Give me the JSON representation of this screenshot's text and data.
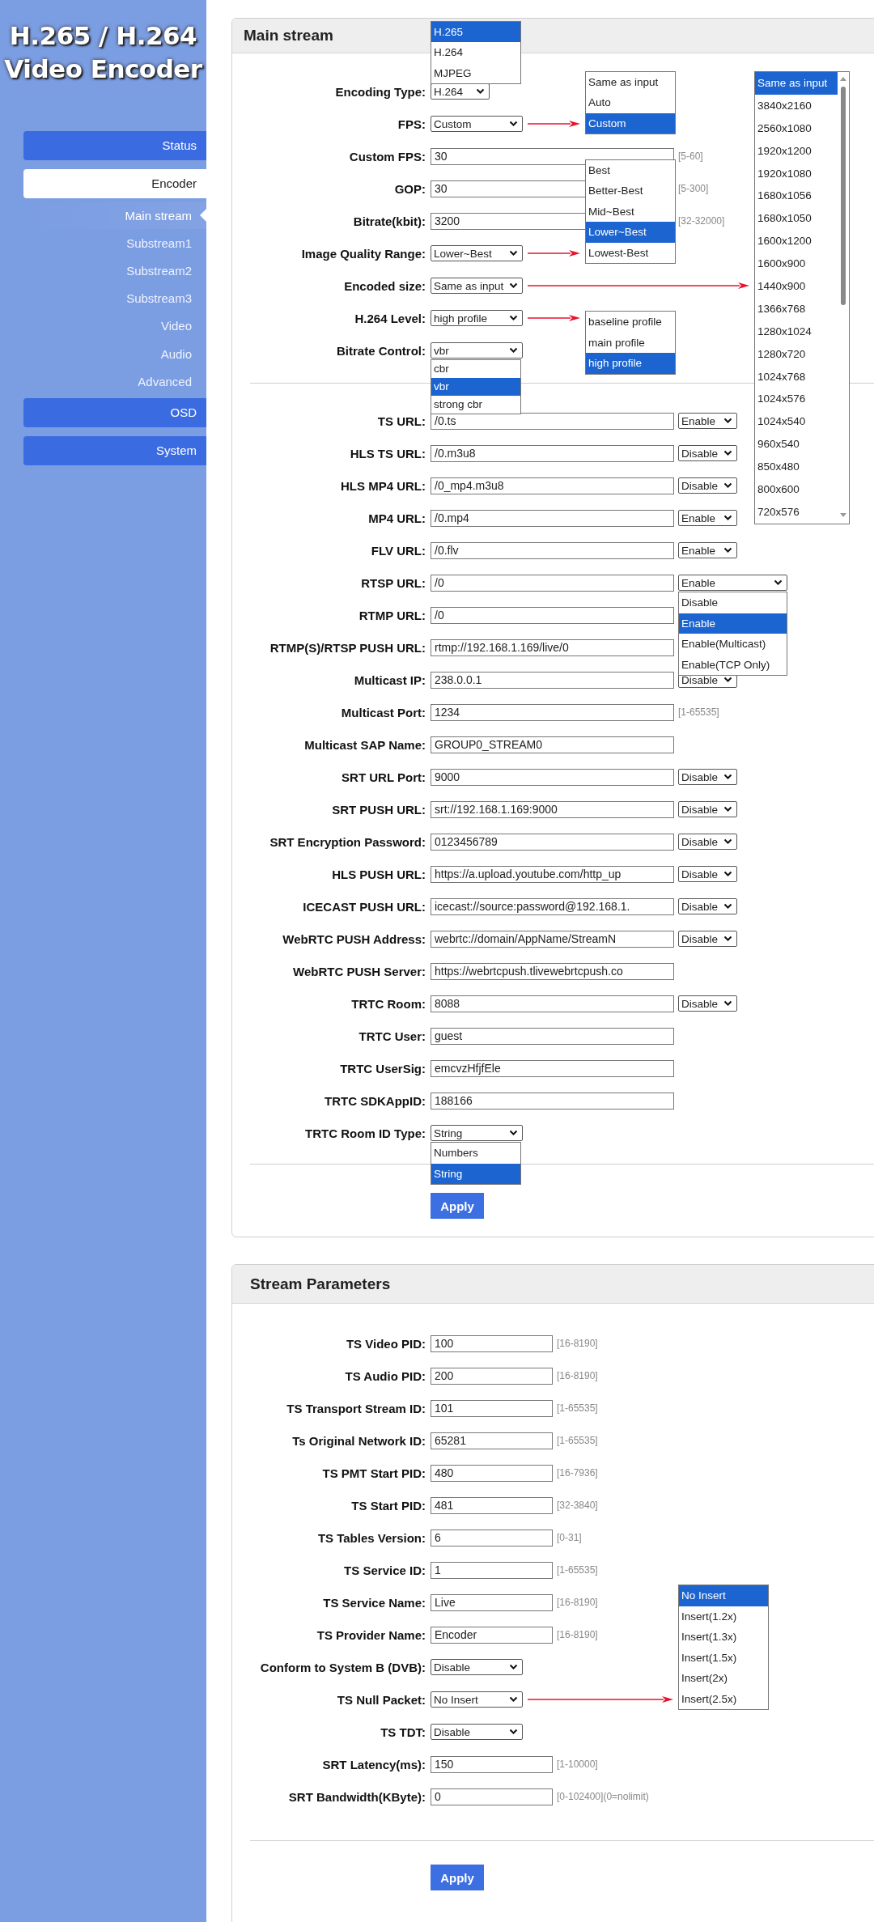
{
  "brand": {
    "title_lines": [
      "H.265 / H.264",
      "Video Encoder"
    ]
  },
  "sidebar": {
    "items": [
      {
        "label": "Status",
        "kind": "button",
        "selected": false
      },
      {
        "label": "Encoder",
        "kind": "button",
        "selected": true
      },
      {
        "label": "Main stream",
        "kind": "subitem",
        "selected": true
      },
      {
        "label": "Substream1",
        "kind": "subitem",
        "selected": false
      },
      {
        "label": "Substream2",
        "kind": "subitem",
        "selected": false
      },
      {
        "label": "Substream3",
        "kind": "subitem",
        "selected": false
      },
      {
        "label": "Video",
        "kind": "subitem",
        "selected": false
      },
      {
        "label": "Audio",
        "kind": "subitem",
        "selected": false
      },
      {
        "label": "Advanced",
        "kind": "subitem",
        "selected": false
      },
      {
        "label": "OSD",
        "kind": "button",
        "selected": false
      },
      {
        "label": "System",
        "kind": "button",
        "selected": false
      }
    ]
  },
  "panels": [
    {
      "title": "Main stream",
      "kind": "wide",
      "apply": "Apply",
      "sections": [
        [
          {
            "label": "Encoding Type:",
            "kind": "compact-select",
            "value": "H.264",
            "dropdown": {
              "options": [
                {
                  "label": "H.265",
                  "selected": true
                },
                {
                  "label": "H.264",
                  "selected": false
                },
                {
                  "label": "MJPEG",
                  "selected": false
                }
              ]
            }
          },
          {
            "label": "FPS:",
            "kind": "select",
            "value": "Custom",
            "dropdown": {
              "options": [
                {
                  "label": "Same as input",
                  "selected": false
                },
                {
                  "label": "Auto",
                  "selected": false
                },
                {
                  "label": "Custom",
                  "selected": true
                }
              ]
            }
          },
          {
            "label": "Custom FPS:",
            "kind": "text",
            "value": "30",
            "side": {
              "kind": "hint",
              "text": "[5-60]"
            }
          },
          {
            "label": "GOP:",
            "kind": "text",
            "value": "30",
            "side": {
              "kind": "hint",
              "text": "[5-300]"
            }
          },
          {
            "label": "Bitrate(kbit):",
            "kind": "text",
            "value": "3200",
            "side": {
              "kind": "hint",
              "text": "[32-32000]"
            }
          },
          {
            "label": "Image Quality Range:",
            "kind": "select",
            "value": "Lower~Best",
            "dropdown": {
              "options": [
                {
                  "label": "Best",
                  "selected": false
                },
                {
                  "label": "Better-Best",
                  "selected": false
                },
                {
                  "label": "Mid~Best",
                  "selected": false
                },
                {
                  "label": "Lower~Best",
                  "selected": true
                },
                {
                  "label": "Lowest-Best",
                  "selected": false
                }
              ]
            }
          },
          {
            "label": "Encoded size:",
            "kind": "select",
            "value": "Same as input",
            "dropdown": {
              "options": [
                {
                  "label": "Same as input",
                  "selected": true
                },
                {
                  "label": "3840x2160",
                  "selected": false
                },
                {
                  "label": "2560x1080",
                  "selected": false
                },
                {
                  "label": "1920x1200",
                  "selected": false
                },
                {
                  "label": "1920x1080",
                  "selected": false
                },
                {
                  "label": "1680x1056",
                  "selected": false
                },
                {
                  "label": "1680x1050",
                  "selected": false
                },
                {
                  "label": "1600x1200",
                  "selected": false
                },
                {
                  "label": "1600x900",
                  "selected": false
                },
                {
                  "label": "1440x900",
                  "selected": false
                },
                {
                  "label": "1366x768",
                  "selected": false
                },
                {
                  "label": "1280x1024",
                  "selected": false
                },
                {
                  "label": "1280x720",
                  "selected": false
                },
                {
                  "label": "1024x768",
                  "selected": false
                },
                {
                  "label": "1024x576",
                  "selected": false
                },
                {
                  "label": "1024x540",
                  "selected": false
                },
                {
                  "label": "960x540",
                  "selected": false
                },
                {
                  "label": "850x480",
                  "selected": false
                },
                {
                  "label": "800x600",
                  "selected": false
                },
                {
                  "label": "720x576",
                  "selected": false
                }
              ]
            }
          },
          {
            "label": "H.264 Level:",
            "kind": "select",
            "value": "high profile",
            "dropdown": {
              "options": [
                {
                  "label": "baseline profile",
                  "selected": false
                },
                {
                  "label": "main profile",
                  "selected": false
                },
                {
                  "label": "high profile",
                  "selected": true
                }
              ]
            }
          },
          {
            "label": "Bitrate Control:",
            "kind": "select",
            "value": "vbr",
            "dropdown": {
              "options": [
                {
                  "label": "cbr",
                  "selected": false
                },
                {
                  "label": "vbr",
                  "selected": true
                },
                {
                  "label": "strong cbr",
                  "selected": false
                }
              ]
            }
          }
        ],
        [
          {
            "label": "TS URL:",
            "kind": "text",
            "value": "/0.ts",
            "side": {
              "kind": "select",
              "value": "Enable"
            }
          },
          {
            "label": "HLS TS URL:",
            "kind": "text",
            "value": "/0.m3u8",
            "side": {
              "kind": "select",
              "value": "Disable"
            }
          },
          {
            "label": "HLS MP4 URL:",
            "kind": "text",
            "value": "/0_mp4.m3u8",
            "side": {
              "kind": "select",
              "value": "Disable"
            }
          },
          {
            "label": "MP4 URL:",
            "kind": "text",
            "value": "/0.mp4",
            "side": {
              "kind": "select",
              "value": "Enable"
            }
          },
          {
            "label": "FLV URL:",
            "kind": "text",
            "value": "/0.flv",
            "side": {
              "kind": "select",
              "value": "Enable"
            }
          },
          {
            "label": "RTSP URL:",
            "kind": "text",
            "value": "/0",
            "side": {
              "kind": "select",
              "value": "Enable",
              "dropdown": {
                "options": [
                  {
                    "label": "Disable",
                    "selected": false
                  },
                  {
                    "label": "Enable",
                    "selected": true
                  },
                  {
                    "label": "Enable(Multicast)",
                    "selected": false
                  },
                  {
                    "label": "Enable(TCP Only)",
                    "selected": false
                  }
                ]
              }
            }
          },
          {
            "label": "RTMP URL:",
            "kind": "text",
            "value": "/0"
          },
          {
            "label": "RTMP(S)/RTSP PUSH URL:",
            "kind": "text",
            "value": "rtmp://192.168.1.169/live/0"
          },
          {
            "label": "Multicast IP:",
            "kind": "text",
            "value": "238.0.0.1",
            "side": {
              "kind": "select",
              "value": "Disable"
            }
          },
          {
            "label": "Multicast Port:",
            "kind": "text",
            "value": "1234",
            "side": {
              "kind": "hint",
              "text": "[1-65535]"
            }
          },
          {
            "label": "Multicast SAP Name:",
            "kind": "text",
            "value": "GROUP0_STREAM0"
          },
          {
            "label": "SRT URL Port:",
            "kind": "text",
            "value": "9000",
            "side": {
              "kind": "select",
              "value": "Disable"
            }
          },
          {
            "label": "SRT PUSH URL:",
            "kind": "text",
            "value": "srt://192.168.1.169:9000",
            "side": {
              "kind": "select",
              "value": "Disable"
            }
          },
          {
            "label": "SRT Encryption Password:",
            "kind": "text",
            "value": "0123456789",
            "side": {
              "kind": "select",
              "value": "Disable"
            }
          },
          {
            "label": "HLS PUSH URL:",
            "kind": "text",
            "value": "https://a.upload.youtube.com/http_up",
            "side": {
              "kind": "select",
              "value": "Disable"
            }
          },
          {
            "label": "ICECAST PUSH URL:",
            "kind": "text",
            "value": "icecast://source:password@192.168.1.",
            "side": {
              "kind": "select",
              "value": "Disable"
            }
          },
          {
            "label": "WebRTC PUSH Address:",
            "kind": "text",
            "value": "webrtc://domain/AppName/StreamN",
            "side": {
              "kind": "select",
              "value": "Disable"
            }
          },
          {
            "label": "WebRTC PUSH Server:",
            "kind": "text",
            "value": "https://webrtcpush.tlivewebrtcpush.co"
          },
          {
            "label": "TRTC Room:",
            "kind": "text",
            "value": "8088",
            "side": {
              "kind": "select",
              "value": "Disable"
            }
          },
          {
            "label": "TRTC User:",
            "kind": "text",
            "value": "guest"
          },
          {
            "label": "TRTC UserSig:",
            "kind": "text",
            "value": "emcvzHfjfEle"
          },
          {
            "label": "TRTC SDKAppID:",
            "kind": "text",
            "value": "188166"
          },
          {
            "label": "TRTC Room ID Type:",
            "kind": "select",
            "value": "String",
            "dropdown": {
              "options": [
                {
                  "label": "Numbers",
                  "selected": false
                },
                {
                  "label": "String",
                  "selected": true
                }
              ]
            }
          }
        ]
      ]
    },
    {
      "title": "Stream Parameters",
      "kind": "narrow",
      "apply": "Apply",
      "sections": [
        [
          {
            "label": "TS Video PID:",
            "kind": "text",
            "value": "100",
            "side": {
              "kind": "hint",
              "text": "[16-8190]"
            }
          },
          {
            "label": "TS Audio PID:",
            "kind": "text",
            "value": "200",
            "side": {
              "kind": "hint",
              "text": "[16-8190]"
            }
          },
          {
            "label": "TS Transport Stream ID:",
            "kind": "text",
            "value": "101",
            "side": {
              "kind": "hint",
              "text": "[1-65535]"
            }
          },
          {
            "label": "Ts Original Network ID:",
            "kind": "text",
            "value": "65281",
            "side": {
              "kind": "hint",
              "text": "[1-65535]"
            }
          },
          {
            "label": "TS PMT Start PID:",
            "kind": "text",
            "value": "480",
            "side": {
              "kind": "hint",
              "text": "[16-7936]"
            }
          },
          {
            "label": "TS Start PID:",
            "kind": "text",
            "value": "481",
            "side": {
              "kind": "hint",
              "text": "[32-3840]"
            }
          },
          {
            "label": "TS Tables Version:",
            "kind": "text",
            "value": "6",
            "side": {
              "kind": "hint",
              "text": "[0-31]"
            }
          },
          {
            "label": "TS Service ID:",
            "kind": "text",
            "value": "1",
            "side": {
              "kind": "hint",
              "text": "[1-65535]"
            }
          },
          {
            "label": "TS Service Name:",
            "kind": "text",
            "value": "Live",
            "side": {
              "kind": "hint",
              "text": "[16-8190]"
            }
          },
          {
            "label": "TS Provider Name:",
            "kind": "text",
            "value": "Encoder",
            "side": {
              "kind": "hint",
              "text": "[16-8190]"
            }
          },
          {
            "label": "Conform to System B (DVB):",
            "kind": "select",
            "value": "Disable"
          },
          {
            "label": "TS Null Packet:",
            "kind": "select",
            "value": "No Insert",
            "dropdown": {
              "options": [
                {
                  "label": "No Insert",
                  "selected": true
                },
                {
                  "label": "Insert(1.2x)",
                  "selected": false
                },
                {
                  "label": "Insert(1.3x)",
                  "selected": false
                },
                {
                  "label": "Insert(1.5x)",
                  "selected": false
                },
                {
                  "label": "Insert(2x)",
                  "selected": false
                },
                {
                  "label": "Insert(2.5x)",
                  "selected": false
                }
              ]
            }
          },
          {
            "label": "TS TDT:",
            "kind": "select",
            "value": "Disable"
          },
          {
            "label": "SRT Latency(ms):",
            "kind": "text",
            "value": "150",
            "side": {
              "kind": "hint",
              "text": "[1-10000]"
            }
          },
          {
            "label": "SRT Bandwidth(KByte):",
            "kind": "text",
            "value": "0",
            "side": {
              "kind": "hint",
              "text": "[0-102400](0=nolimit)"
            }
          }
        ]
      ]
    }
  ]
}
